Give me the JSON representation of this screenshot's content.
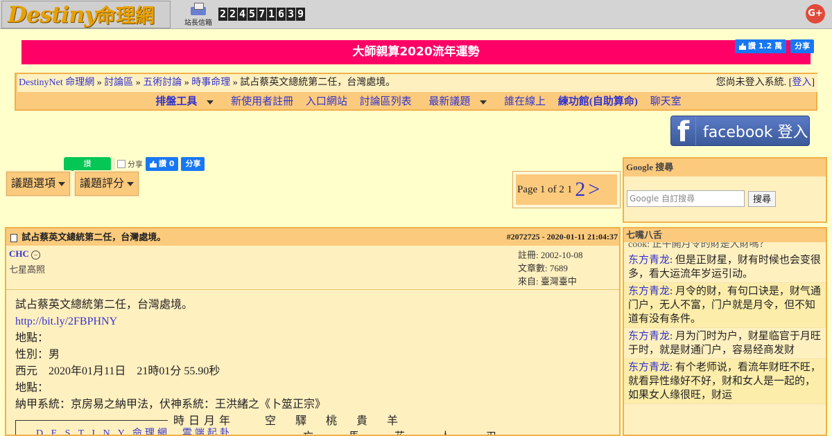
{
  "header": {
    "logo_en": "Destiny",
    "logo_zh": "命理網",
    "mailbox_label": "站長信箱",
    "counter_digits": [
      "2",
      "2",
      "4",
      "5",
      "7",
      "1",
      "6",
      "3",
      "9"
    ],
    "gplus_label": "G+"
  },
  "banner": {
    "text": "大師親算2020流年運勢",
    "fb_like_label": "讚 1.2 萬",
    "fb_share_label": "分享"
  },
  "breadcrumb": {
    "items": [
      "DestinyNet 命理網",
      "討論區",
      "五術討論",
      "時事命理"
    ],
    "separator": "»",
    "current": "試占蔡英文總統第二任，台灣處境。",
    "login_status": "您尚未登入系統.",
    "login_link": "登入"
  },
  "nav": {
    "items": [
      "排盤工具",
      "新使用者註冊",
      "入口網站",
      "討論區列表",
      "最新議題",
      "誰在線上",
      "練功館(自助算命)",
      "聊天室"
    ]
  },
  "facebook_login": {
    "f": "f",
    "label": "facebook 登入"
  },
  "share_row": {
    "line_label": "讚",
    "share_label": "分享",
    "fb_like_label": "讚 0",
    "fb_share_label": "分享"
  },
  "topic": {
    "options_label": "議題選項",
    "rating_label": "議題評分"
  },
  "pager": {
    "text": "Page 1 of 2",
    "page1": "1",
    "page2": "2",
    "next": ">"
  },
  "google_search": {
    "title": "Google 搜尋",
    "placeholder": "Google 自訂搜尋",
    "button": "搜尋"
  },
  "post": {
    "title": "試占蔡英文總統第二任，台灣處境。",
    "id_time": "#2072725 - 2020-01-11 21:04:37",
    "author": "CHC",
    "author_title": "七星高照",
    "registered": "註冊: 2002-10-08",
    "post_count": "文章數: 7689",
    "location": "來自: 臺灣臺中",
    "body_lines": [
      "試占蔡英文總統第二任，台灣處境。",
      "http://bit.ly/2FBPHNY",
      "地點：",
      "性別：男",
      "西元　2020年01月11日　21時01分 55.90秒",
      "地點：",
      "納甲系統：京房易之納甲法，伏神系統：王洪緒之《卜筮正宗》"
    ],
    "chart_title": "D E S T I N Y 命理網　雲端起卦",
    "chart_header": "時日月年　　空　驛　桃　貴　羊",
    "chart_row2": "亡　馬　花　人　刃"
  },
  "chat": {
    "title": "七嘴八舌",
    "cut_text": "cook: 正午開月令的財是大財嗎？",
    "items": [
      {
        "name": "东方青龙",
        "text": ": 但是正财星，财有时候也会变很多，看大运流年岁运引动。"
      },
      {
        "name": "东方青龙",
        "text": ": 月令的财，有句口诀是，财气通门户，无人不富，门户就是月令，但不知道有没有条件。"
      },
      {
        "name": "东方青龙",
        "text": ": 月为门时为户，财星临官于月旺于时，就是财通门户，容易经商发财"
      },
      {
        "name": "东方青龙",
        "text": ": 有个老师说，看流年财旺不旺，就看异性缘好不好，财和女人是一起的，如果女人缘很旺，财运"
      }
    ]
  }
}
